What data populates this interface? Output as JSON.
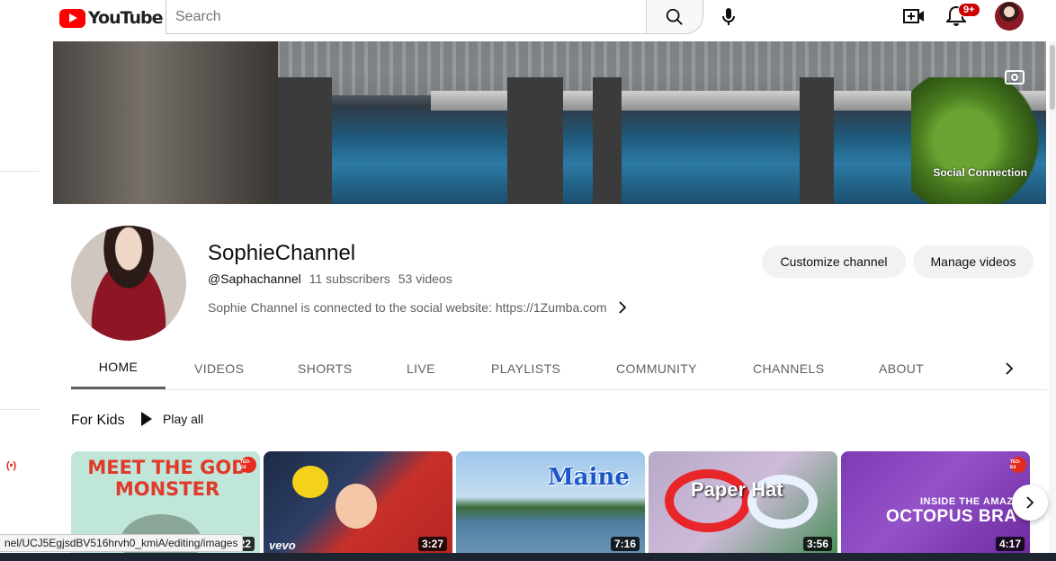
{
  "header": {
    "logo_text": "YouTube",
    "search_placeholder": "Search",
    "notification_count": "9+"
  },
  "banner": {
    "caption": "Social Connection"
  },
  "channel": {
    "name": "SophieChannel",
    "handle": "@Saphachannel",
    "subscribers": "11 subscribers",
    "videos": "53 videos",
    "description": "Sophie Channel is connected to the social website: https://1Zumba.com",
    "customize_label": "Customize channel",
    "manage_label": "Manage videos"
  },
  "tabs": [
    {
      "label": "HOME",
      "active": true
    },
    {
      "label": "VIDEOS"
    },
    {
      "label": "SHORTS"
    },
    {
      "label": "LIVE"
    },
    {
      "label": "PLAYLISTS"
    },
    {
      "label": "COMMUNITY"
    },
    {
      "label": "CHANNELS"
    },
    {
      "label": "ABOUT"
    }
  ],
  "section": {
    "title": "For Kids",
    "play_all_label": "Play all",
    "videos": [
      {
        "thumb_text": "MEET THE GOD MONSTER",
        "badge": "TED-Ed",
        "duration": "5:22"
      },
      {
        "thumb_text": "vevo",
        "duration": "3:27"
      },
      {
        "thumb_text": "Maine",
        "duration": "7:16"
      },
      {
        "thumb_text": "Paper Hat",
        "duration": "3:56"
      },
      {
        "thumb_text_small": "INSIDE THE AMAZ",
        "thumb_text": "OCTOPUS BRA",
        "badge": "TED-Ed",
        "duration": "4:17"
      }
    ]
  },
  "status_bar": {
    "url": "nel/UCJ5EgjsdBV516hrvh0_kmiA/editing/images"
  },
  "colors": {
    "brand_red": "#ff0000",
    "badge_red": "#cc0000",
    "button_bg": "#f2f2f2",
    "text_secondary": "#606060"
  }
}
